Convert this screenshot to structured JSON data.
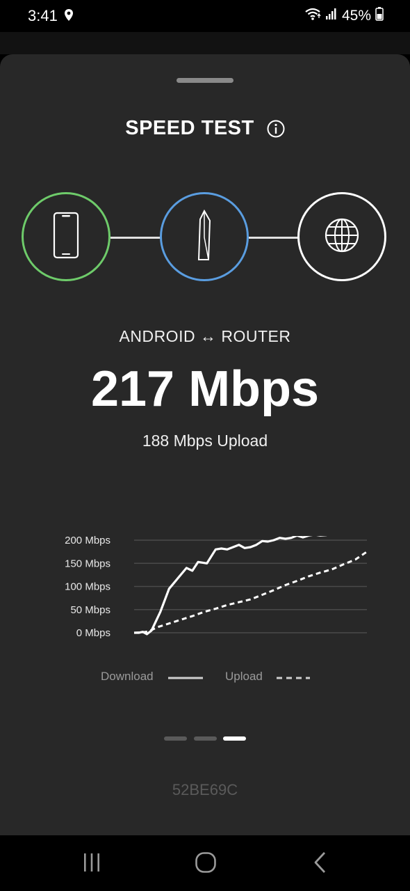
{
  "status_bar": {
    "time": "3:41",
    "battery_text": "45%",
    "icons": [
      "location-icon",
      "wifi-icon",
      "signal-icon",
      "battery-icon"
    ]
  },
  "sheet": {
    "title": "SPEED TEST",
    "info_icon": "info-icon",
    "nodes": [
      {
        "name": "phone",
        "icon": "phone-icon",
        "ring_color": "#6ecb6a"
      },
      {
        "name": "router",
        "icon": "router-icon",
        "ring_color": "#5a9de0"
      },
      {
        "name": "internet",
        "icon": "globe-icon",
        "ring_color": "#ffffff"
      }
    ],
    "connection_label": "ANDROID ↔ ROUTER",
    "download_speed": "217 Mbps",
    "upload_speed": "188 Mbps Upload",
    "legend": {
      "download": "Download",
      "upload": "Upload"
    },
    "page_indicator": {
      "total": 3,
      "active": 3
    },
    "device_id": "52BE69C"
  },
  "chart_data": {
    "type": "line",
    "y_tick_labels": [
      "200 Mbps",
      "150 Mbps",
      "100 Mbps",
      "50 Mbps",
      "0 Mbps"
    ],
    "ylim": [
      0,
      200
    ],
    "grid": true,
    "legend_position": "bottom",
    "series": [
      {
        "name": "Download",
        "style": "solid",
        "x": [
          0,
          0.8,
          1.5,
          2.2,
          3,
          4.5,
          6,
          8,
          9,
          10,
          11,
          12.5,
          14,
          15,
          16,
          18,
          19,
          20,
          21,
          22,
          23,
          24,
          25,
          26,
          27,
          28,
          29,
          30,
          31,
          32,
          33,
          34,
          35,
          36,
          37,
          38,
          39,
          40
        ],
        "y": [
          0,
          0,
          2,
          -3,
          5,
          45,
          95,
          125,
          140,
          134,
          153,
          150,
          180,
          182,
          180,
          190,
          183,
          185,
          190,
          198,
          197,
          200,
          205,
          203,
          205,
          210,
          206,
          210,
          212,
          210,
          211,
          215,
          212,
          220,
          218,
          215,
          218,
          218
        ]
      },
      {
        "name": "Upload",
        "style": "dashed",
        "x": [
          0,
          1.5,
          2.5,
          4,
          6,
          8,
          10,
          12,
          14,
          16,
          18,
          20,
          22,
          24,
          26,
          28,
          30,
          32,
          34,
          36,
          38,
          40
        ],
        "y": [
          0,
          1,
          3,
          12,
          20,
          28,
          36,
          45,
          52,
          60,
          66,
          72,
          82,
          92,
          103,
          112,
          122,
          130,
          137,
          148,
          158,
          175
        ]
      }
    ]
  }
}
